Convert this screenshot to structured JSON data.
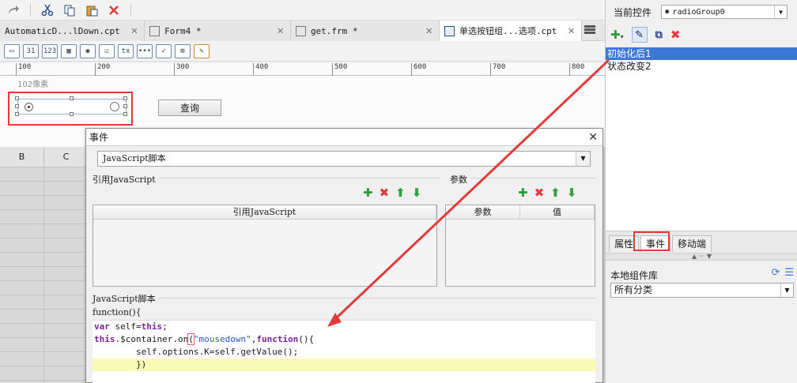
{
  "toolbar": {
    "icons": [
      "redo-icon",
      "cut-icon",
      "copy-icon",
      "paste-icon",
      "delete-icon"
    ]
  },
  "tabs": [
    {
      "label": "AutomaticD...lDown.cpt",
      "active": false
    },
    {
      "label": "Form4 *",
      "active": false
    },
    {
      "label": "get.frm *",
      "active": false
    },
    {
      "label": "单选按钮组...选项.cpt",
      "active": true
    }
  ],
  "ruler": {
    "labels": [
      "100",
      "200",
      "300",
      "400",
      "500",
      "600",
      "700",
      "800"
    ]
  },
  "canvas": {
    "pixel_label": "102像素",
    "query_button": "查询"
  },
  "sheet": {
    "columns": [
      "B",
      "C"
    ]
  },
  "dialog": {
    "title": "事件",
    "type_select": "JavaScript脚本",
    "ref_js_group": "引用JavaScript",
    "ref_js_header": "引用JavaScript",
    "params_group": "参数",
    "params_headers": [
      "参数",
      "值"
    ],
    "script_group": "JavaScript脚本",
    "function_header": "function(){",
    "code": {
      "line1_kw": "var",
      "line1_rest": " self=",
      "line1_kw2": "this",
      "line1_end": ";",
      "line2_kw": "this",
      "line2_a": ".$container.on",
      "line2_paren": "(",
      "line2_str": "\"mousedown\"",
      "line2_b": ",",
      "line2_kw2": "function",
      "line2_c": "(){",
      "line3": "        self.options.K=self.getValue();",
      "line4": "        })"
    }
  },
  "right_pane": {
    "current_widget_label": "当前控件",
    "current_widget_value": "radioGroup0",
    "events": [
      {
        "label": "初始化后1",
        "selected": true
      },
      {
        "label": "状态改变2",
        "selected": false
      }
    ],
    "tabs": [
      "属性",
      "事件",
      "移动端"
    ],
    "active_tab": "事件",
    "library_title": "本地组件库",
    "library_select": "所有分类"
  },
  "colors": {
    "accent": "#3b78d6",
    "annotation": "#e33a3a",
    "add": "#2e9e39",
    "delete": "#e23a3a"
  }
}
